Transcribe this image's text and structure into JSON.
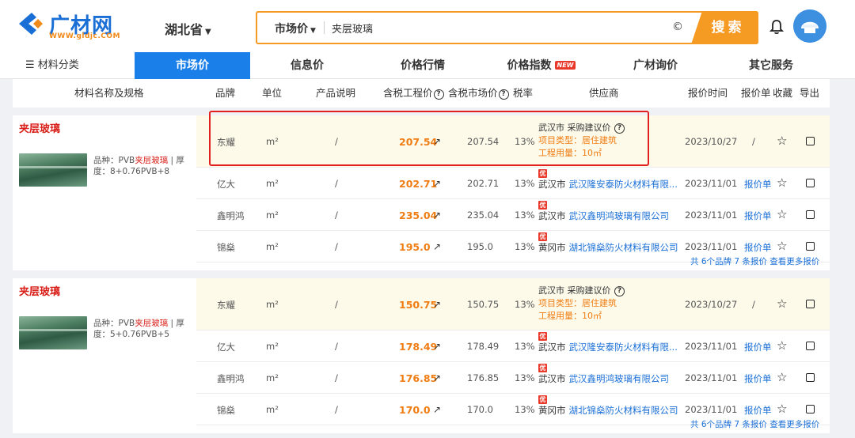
{
  "header": {
    "logo_text": "广材网",
    "logo_sub": "WWW.gldjc.COM",
    "province": "湖北省",
    "search": {
      "type": "市场价",
      "value": "夹层玻璃",
      "button": "搜索"
    }
  },
  "nav": {
    "category": "材料分类",
    "tabs": [
      {
        "label": "市场价"
      },
      {
        "label": "信息价"
      },
      {
        "label": "价格行情"
      },
      {
        "label": "价格指数",
        "badge": "NEW"
      },
      {
        "label": "广材询价"
      },
      {
        "label": "其它服务"
      }
    ]
  },
  "table": {
    "headers": {
      "name": "材料名称及规格",
      "brand": "品牌",
      "unit": "单位",
      "desc": "产品说明",
      "tax_price": "含税工程价",
      "mkt_price": "含税市场价",
      "tax": "税率",
      "supplier": "供应商",
      "date": "报价时间",
      "quote": "报价单",
      "fav": "收藏",
      "export": "导出"
    },
    "groups": [
      {
        "title": "夹层玻璃",
        "desc_prefix": "品种：PVB",
        "desc_hl": "夹层玻璃",
        "desc_suffix": " | 厚度：8+0.76PVB+8",
        "more": "共 6个品牌 7 条报价 查看更多报价",
        "rows": [
          {
            "brand": "东耀",
            "unit": "m²",
            "desc": "/",
            "price": "207.54",
            "mkt": "207.54",
            "tax": "13%",
            "sup_city": "武汉市",
            "sup_name": "采购建议价",
            "project_type": "项目类型：居住建筑",
            "usage": "工程用量：10㎡",
            "date": "2023/10/27",
            "quote": "/"
          },
          {
            "brand": "亿大",
            "unit": "m²",
            "desc": "/",
            "price": "202.71",
            "mkt": "202.71",
            "tax": "13%",
            "you": "优",
            "sup_city": "武汉市",
            "sup_name": "武汉隆安泰防火材料有限...",
            "date": "2023/11/01",
            "quote": "报价单"
          },
          {
            "brand": "鑫明鸿",
            "unit": "m²",
            "desc": "/",
            "price": "235.04",
            "mkt": "235.04",
            "tax": "13%",
            "you": "优",
            "sup_city": "武汉市",
            "sup_name": "武汉鑫明鸿玻璃有限公司",
            "date": "2023/11/01",
            "quote": "报价单"
          },
          {
            "brand": "锦燊",
            "unit": "m²",
            "desc": "/",
            "price": "195.0",
            "mkt": "195.0",
            "tax": "13%",
            "you": "优",
            "sup_city": "黄冈市",
            "sup_name": "湖北锦燊防火材料有限公司",
            "date": "2023/11/01",
            "quote": "报价单"
          }
        ]
      },
      {
        "title": "夹层玻璃",
        "desc_prefix": "品种：PVB",
        "desc_hl": "夹层玻璃",
        "desc_suffix": " | 厚度：5+0.76PVB+5",
        "more": "共 6个品牌 7 条报价 查看更多报价",
        "rows": [
          {
            "brand": "东耀",
            "unit": "m²",
            "desc": "/",
            "price": "150.75",
            "mkt": "150.75",
            "tax": "13%",
            "sup_city": "武汉市",
            "sup_name": "采购建议价",
            "project_type": "项目类型：居住建筑",
            "usage": "工程用量：10㎡",
            "date": "2023/10/27",
            "quote": "/"
          },
          {
            "brand": "亿大",
            "unit": "m²",
            "desc": "/",
            "price": "178.49",
            "mkt": "178.49",
            "tax": "13%",
            "you": "优",
            "sup_city": "武汉市",
            "sup_name": "武汉隆安泰防火材料有限...",
            "date": "2023/11/01",
            "quote": "报价单"
          },
          {
            "brand": "鑫明鸿",
            "unit": "m²",
            "desc": "/",
            "price": "176.85",
            "mkt": "176.85",
            "tax": "13%",
            "you": "优",
            "sup_city": "武汉市",
            "sup_name": "武汉鑫明鸿玻璃有限公司",
            "date": "2023/11/01",
            "quote": "报价单"
          },
          {
            "brand": "锦燊",
            "unit": "m²",
            "desc": "/",
            "price": "170.0",
            "mkt": "170.0",
            "tax": "13%",
            "you": "优",
            "sup_city": "黄冈市",
            "sup_name": "湖北锦燊防火材料有限公司",
            "date": "2023/11/01",
            "quote": "报价单"
          }
        ]
      }
    ]
  },
  "colors": {
    "accent": "#1a7fe8",
    "orange": "#f59a23",
    "red": "#d9201a",
    "highlight": "#e32020"
  }
}
